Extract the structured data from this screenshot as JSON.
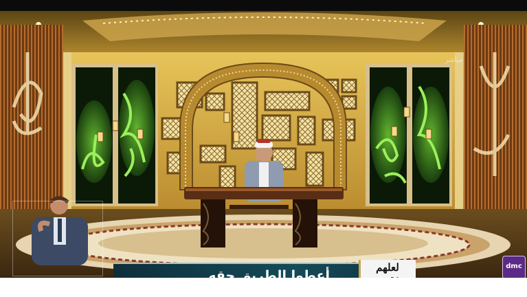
{
  "ticker": {
    "headline": "أعطوا الطريق حقه"
  },
  "program_logo": {
    "text": "لعلهم يفقهون"
  },
  "channel": {
    "logo_text": "dmc",
    "watermark": "مباشر"
  },
  "colors": {
    "studio_gold": "#d9b24a",
    "ticker_bg": "#154a58",
    "channel_purple": "#5b2a86",
    "calligraphy_green": "#6fd13a"
  }
}
